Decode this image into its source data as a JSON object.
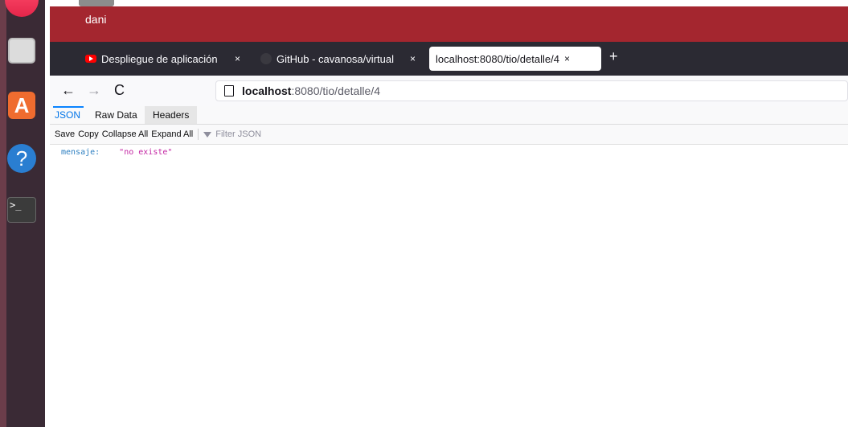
{
  "titlebar": {
    "user": "dani"
  },
  "tabs": [
    {
      "label": "Despliegue de aplicación",
      "close": "×",
      "icon": "youtube-icon"
    },
    {
      "label": "GitHub - cavanosa/virtual",
      "close": "×",
      "icon": "github-icon"
    },
    {
      "label": "localhost:8080/tio/detalle/4",
      "close": "×",
      "active": true
    }
  ],
  "new_tab": "+",
  "nav": {
    "back": "←",
    "forward": "→",
    "reload": "C"
  },
  "url": {
    "host": "localhost",
    "path": ":8080/tio/detalle/4"
  },
  "json_viewer": {
    "tabs": [
      "JSON",
      "Raw Data",
      "Headers"
    ],
    "toolbar": {
      "save": "Save",
      "copy": "Copy",
      "collapse": "Collapse All",
      "expand": "Expand All",
      "filter_placeholder": "Filter JSON"
    },
    "rows": [
      {
        "key": "mensaje:",
        "value": "\"no existe\""
      }
    ]
  },
  "colors": {
    "titlebar": "#a4262f",
    "tabstrip": "#2b2a33",
    "json_key": "#2d7fc1",
    "json_string": "#c325a3"
  }
}
